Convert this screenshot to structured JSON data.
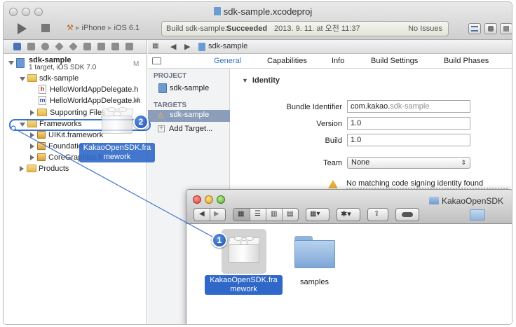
{
  "xcode": {
    "document_title": "sdk-sample.xcodeproj",
    "scheme": {
      "target": "iPhone",
      "sdk": "iOS 6.1"
    },
    "activity": {
      "status_prefix": "Build sdk-sample:",
      "status_value": "Succeeded",
      "timestamp": "2013. 9. 11. at 오전 11:37",
      "issues": "No Issues"
    },
    "jump_bar": {
      "crumb": "sdk-sample"
    },
    "editor_tabs": [
      "General",
      "Capabilities",
      "Info",
      "Build Settings",
      "Build Phases"
    ],
    "navigator": {
      "project_name": "sdk-sample",
      "project_subtitle": "1 target, iOS SDK 7.0",
      "project_badge": "M",
      "items": [
        {
          "label": "sdk-sample",
          "kind": "folder"
        },
        {
          "label": "HelloWorldAppDelegate.h",
          "kind": "h-file"
        },
        {
          "label": "HelloWorldAppDelegate.m",
          "kind": "m-file",
          "badge": "M"
        },
        {
          "label": "Supporting Files",
          "kind": "folder"
        },
        {
          "label": "Frameworks",
          "kind": "folder"
        },
        {
          "label": "UIKit.framework",
          "kind": "framework"
        },
        {
          "label": "Foundatio",
          "kind": "framework"
        },
        {
          "label": "CoreGraphics.fr",
          "kind": "framework"
        },
        {
          "label": "Products",
          "kind": "folder"
        }
      ]
    },
    "targets_pane": {
      "project_heading": "PROJECT",
      "project_item": "sdk-sample",
      "targets_heading": "TARGETS",
      "target_item": "sdk-sample",
      "add_target": "Add Target..."
    },
    "identity": {
      "heading": "Identity",
      "bundle_identifier_label": "Bundle Identifier",
      "bundle_identifier_prefix": "com.kakao.",
      "bundle_identifier_suffix": "sdk-sample",
      "version_label": "Version",
      "version_value": "1.0",
      "build_label": "Build",
      "build_value": "1.0",
      "team_label": "Team",
      "team_value": "None",
      "warning": "No matching code signing identity found"
    }
  },
  "finder": {
    "title": "KakaoOpenSDK",
    "items": [
      {
        "label_line1": "KakaoOpenSDK.fra",
        "label_line2": "mework",
        "selected": true
      },
      {
        "label_line1": "samples",
        "selected": false
      }
    ]
  },
  "drag": {
    "ghost_label_line1": "KakaoOpenSDK.fra",
    "ghost_label_line2": "mework",
    "step1": "1",
    "step2": "2"
  },
  "colors": {
    "selection_blue": "#2f68c8",
    "badge_blue": "#1c4fa8",
    "warning_yellow": "#e7b13b",
    "tab_selected": "#3876c4"
  }
}
